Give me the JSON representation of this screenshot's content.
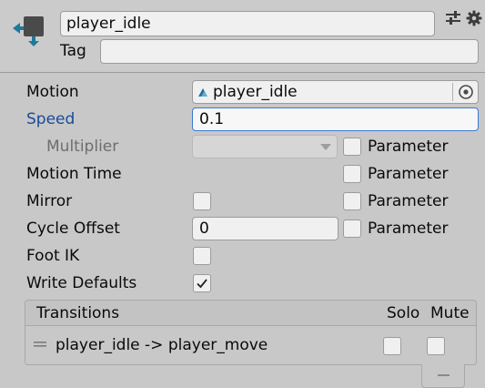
{
  "header": {
    "state_name": "player_idle",
    "tag_label": "Tag",
    "tag_value": ""
  },
  "icons": {
    "state": "animator-state-icon",
    "presets": "presets-sliders-icon",
    "settings": "gear-icon"
  },
  "properties": {
    "motion": {
      "label": "Motion",
      "value": "player_idle"
    },
    "speed": {
      "label": "Speed",
      "value": "0.1"
    },
    "multiplier": {
      "label": "Multiplier",
      "value": ""
    },
    "motion_time": {
      "label": "Motion Time"
    },
    "mirror": {
      "label": "Mirror",
      "checked": false
    },
    "cycle_offset": {
      "label": "Cycle Offset",
      "value": "0"
    },
    "foot_ik": {
      "label": "Foot IK",
      "checked": false
    },
    "write_defaults": {
      "label": "Write Defaults",
      "checked": true
    },
    "parameter_label": "Parameter"
  },
  "transitions": {
    "title": "Transitions",
    "solo_label": "Solo",
    "mute_label": "Mute",
    "items": [
      {
        "name": "player_idle -> player_move",
        "solo": false,
        "mute": false
      }
    ]
  },
  "colors": {
    "background": "#c8c8c8",
    "speed_label": "#1a4a99",
    "focus_border": "#3a79d6",
    "icon_teal": "#1f7a99"
  }
}
